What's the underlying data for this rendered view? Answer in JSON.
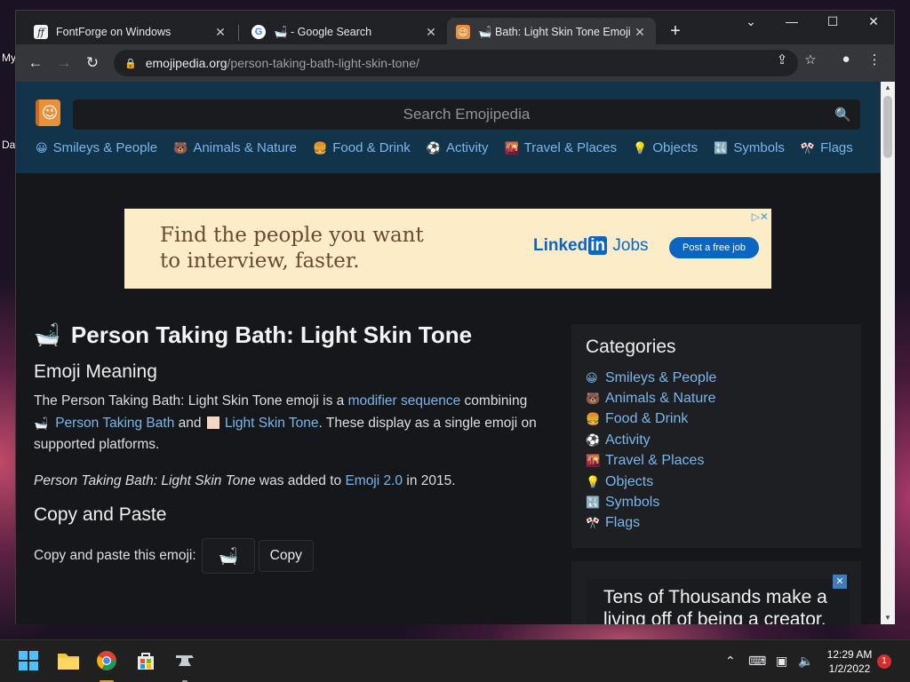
{
  "desktop": {
    "labels": [
      "My",
      "Da"
    ]
  },
  "browser": {
    "tabs": [
      {
        "title": "FontForge on Windows",
        "favicon": "ff",
        "active": false
      },
      {
        "title": "🛁 - Google Search",
        "favicon": "G",
        "active": false
      },
      {
        "title": "🛁 Bath: Light Skin Tone Emoji",
        "favicon": "😉",
        "active": true
      }
    ],
    "new_tab_label": "+",
    "window_controls": {
      "list": "⌄",
      "minimize": "—",
      "maximize": "☐",
      "close": "✕"
    },
    "url_host": "emojipedia.org",
    "url_path": "/person-taking-bath-light-skin-tone/",
    "accent_color": "#7ab6ec"
  },
  "site": {
    "search_placeholder": "Search Emojipedia",
    "nav": [
      {
        "icon": "😀",
        "label": "Smileys & People"
      },
      {
        "icon": "🐻",
        "label": "Animals & Nature"
      },
      {
        "icon": "🍔",
        "label": "Food & Drink"
      },
      {
        "icon": "⚽",
        "label": "Activity"
      },
      {
        "icon": "🌇",
        "label": "Travel & Places"
      },
      {
        "icon": "💡",
        "label": "Objects"
      },
      {
        "icon": "🔣",
        "label": "Symbols"
      },
      {
        "icon": "🎌",
        "label": "Flags"
      }
    ]
  },
  "ad": {
    "headline_line1": "Find the people you want",
    "headline_line2": "to interview, faster.",
    "brand_linked": "Linked",
    "brand_in": "in",
    "brand_jobs": " Jobs",
    "cta": "Post a free job",
    "adchoice": "▷✕"
  },
  "article": {
    "emoji": "🛁",
    "title": "Person Taking Bath: Light Skin Tone",
    "meaning_heading": "Emoji Meaning",
    "p1_a": "The Person Taking Bath: Light Skin Tone emoji is a ",
    "p1_link1": "modifier sequence",
    "p1_b": " combining",
    "p1_emoji": "🛁",
    "p1_link2": "Person Taking Bath",
    "p1_c": " and ",
    "p1_link3": "Light Skin Tone",
    "p1_d": ". These display as a single emoji on supported platforms.",
    "p2_italic": "Person Taking Bath: Light Skin Tone",
    "p2_a": " was added to ",
    "p2_link": "Emoji 2.0",
    "p2_b": " in 2015.",
    "copy_heading": "Copy and Paste",
    "copy_label": "Copy and paste this emoji:",
    "copy_emoji": "🛁",
    "copy_button": "Copy"
  },
  "sidebar": {
    "heading": "Categories",
    "items": [
      {
        "icon": "😀",
        "label": "Smileys & People"
      },
      {
        "icon": "🐻",
        "label": "Animals & Nature"
      },
      {
        "icon": "🍔",
        "label": "Food & Drink"
      },
      {
        "icon": "⚽",
        "label": "Activity"
      },
      {
        "icon": "🌇",
        "label": "Travel & Places"
      },
      {
        "icon": "💡",
        "label": "Objects"
      },
      {
        "icon": "🔣",
        "label": "Symbols"
      },
      {
        "icon": "🎌",
        "label": "Flags"
      }
    ]
  },
  "ad2": {
    "text": "Tens of Thousands make a living off of being a creator.",
    "close": "✕"
  },
  "taskbar": {
    "time": "12:29 AM",
    "date": "1/2/2022",
    "notifications": "1"
  }
}
